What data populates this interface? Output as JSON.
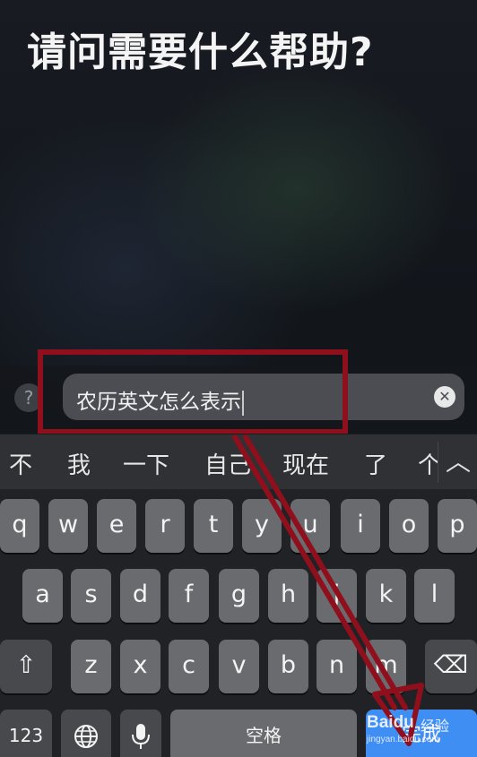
{
  "siri": {
    "prompt": "请问需要什么帮助?"
  },
  "input": {
    "help_glyph": "?",
    "text": "农历英文怎么表示",
    "clear_glyph": "✕"
  },
  "candidates": [
    "不",
    "我",
    "一下",
    "自己",
    "现在",
    "了",
    "个"
  ],
  "candidate_chevron": "︿",
  "keyboard": {
    "row1": [
      "q",
      "w",
      "e",
      "r",
      "t",
      "y",
      "u",
      "i",
      "o",
      "p"
    ],
    "row2": [
      "a",
      "s",
      "d",
      "f",
      "g",
      "h",
      "j",
      "k",
      "l"
    ],
    "row3": [
      "z",
      "x",
      "c",
      "v",
      "b",
      "n",
      "m"
    ],
    "shift_glyph": "⇧",
    "delete_glyph": "⌫",
    "numbers": "123",
    "globe_icon": "globe-icon",
    "mic_icon": "microphone-icon",
    "space": "空格",
    "done": "完成"
  },
  "watermark": {
    "brand": "Baidu",
    "brand_suffix": "经验",
    "url": "jingyan.baidu.com"
  },
  "annotation_color": "#8f0f1c",
  "accent_color": "#3e8ef3"
}
